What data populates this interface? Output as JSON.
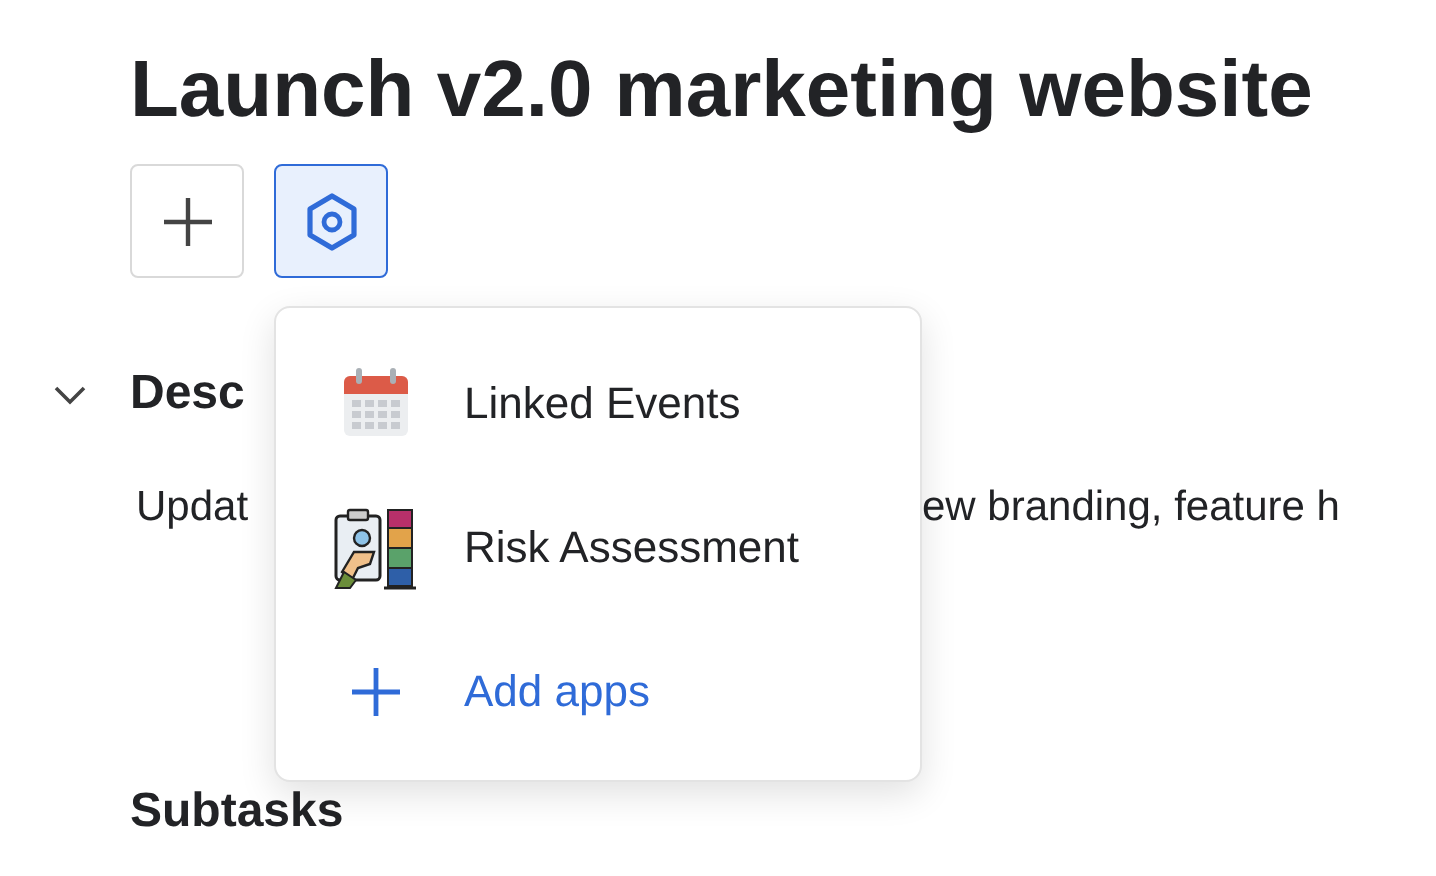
{
  "title": "Launch v2.0 marketing website",
  "toolbar": [
    {
      "kind": "add",
      "selected": false
    },
    {
      "kind": "apps",
      "selected": true
    }
  ],
  "section": {
    "heading": "Desc",
    "expanded": true
  },
  "description": [
    "Updat",
    "ew branding, feature h"
  ],
  "subtasks_heading": "Subtasks",
  "menu": {
    "items": [
      {
        "kind": "calendar",
        "label": "Linked Events"
      },
      {
        "kind": "risk",
        "label": "Risk Assessment"
      },
      {
        "kind": "add",
        "label": "Add apps"
      }
    ]
  }
}
